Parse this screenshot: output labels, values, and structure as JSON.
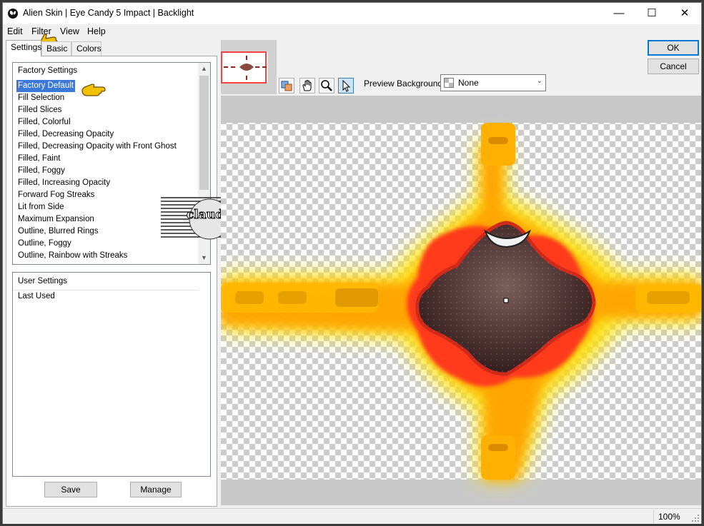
{
  "window": {
    "title": "Alien Skin | Eye Candy 5 Impact | Backlight"
  },
  "window_controls": {
    "minimize": "—",
    "maximize": "☐",
    "close": "✕"
  },
  "menu": {
    "items": [
      "Edit",
      "Filter",
      "View",
      "Help"
    ]
  },
  "tabs": [
    "Settings",
    "Basic",
    "Colors"
  ],
  "factory_list": {
    "header": "Factory Settings",
    "items": [
      "Factory Default",
      "Fill Selection",
      "Filled Slices",
      "Filled, Colorful",
      "Filled, Decreasing Opacity",
      "Filled, Decreasing Opacity with Front Ghost",
      "Filled, Faint",
      "Filled, Foggy",
      "Filled, Increasing Opacity",
      "Forward Fog Streaks",
      "Lit from Side",
      "Maximum Expansion",
      "Outline, Blurred Rings",
      "Outline, Foggy",
      "Outline, Rainbow with Streaks"
    ],
    "selected_index": 0
  },
  "user_list": {
    "header": "User Settings",
    "items": [
      "Last Used"
    ]
  },
  "buttons": {
    "save": "Save",
    "manage": "Manage",
    "ok": "OK",
    "cancel": "Cancel"
  },
  "preview": {
    "background_label": "Preview Background:",
    "background_value": "None",
    "zoom": "100%"
  },
  "watermark": {
    "text": "claudia"
  },
  "colors": {
    "selection": "#3b78d7",
    "accent": "#0078d7",
    "glow_outer": "#ffe000",
    "glow_mid": "#ffa500",
    "glow_inner": "#ff3b1f"
  }
}
